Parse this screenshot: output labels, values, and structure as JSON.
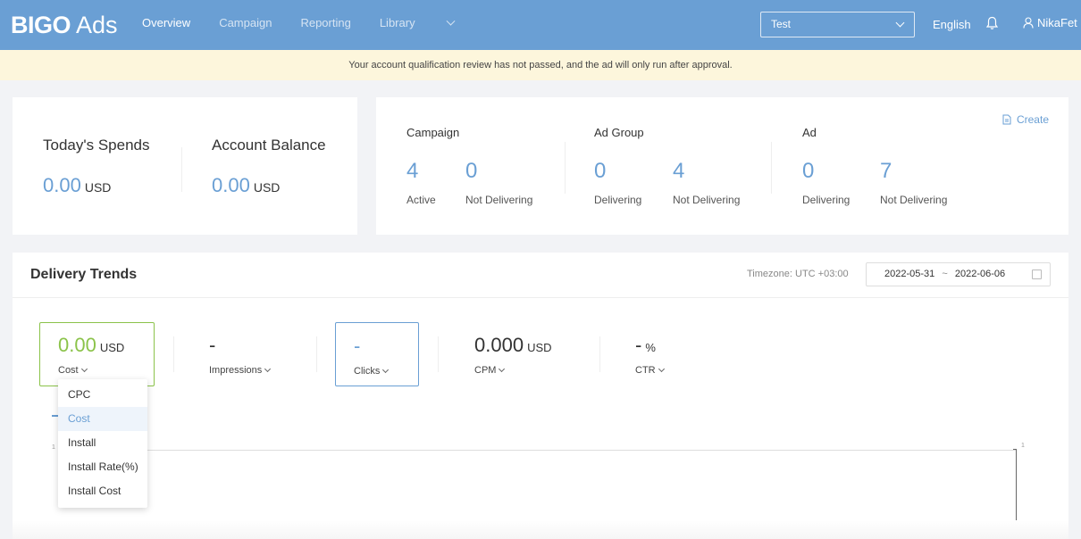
{
  "brand": {
    "bold": "BIGO",
    "light": "Ads"
  },
  "nav": {
    "overview": "Overview",
    "campaign": "Campaign",
    "reporting": "Reporting",
    "library": "Library"
  },
  "account_select": "Test",
  "language": "English",
  "user": "NikaFet",
  "banner": "Your account qualification review has not passed, and the ad will only run after approval.",
  "spend": {
    "today_label": "Today's Spends",
    "today_value": "0.00",
    "today_unit": "USD",
    "balance_label": "Account Balance",
    "balance_value": "0.00",
    "balance_unit": "USD"
  },
  "counts": {
    "create": "Create",
    "campaign": {
      "title": "Campaign",
      "a_num": "4",
      "a_label": "Active",
      "b_num": "0",
      "b_label": "Not Delivering"
    },
    "adgroup": {
      "title": "Ad Group",
      "a_num": "0",
      "a_label": "Delivering",
      "b_num": "4",
      "b_label": "Not Delivering"
    },
    "ad": {
      "title": "Ad",
      "a_num": "0",
      "a_label": "Delivering",
      "b_num": "7",
      "b_label": "Not Delivering"
    }
  },
  "trends": {
    "title": "Delivery Trends",
    "timezone": "Timezone: UTC +03:00",
    "date_start": "2022-05-31",
    "date_sep": "~",
    "date_end": "2022-06-06",
    "metrics": {
      "cost": {
        "value": "0.00",
        "unit": "USD",
        "label": "Cost"
      },
      "impressions": {
        "value": "-",
        "label": "Impressions"
      },
      "clicks": {
        "value": "-",
        "label": "Clicks"
      },
      "cpm": {
        "value": "0.000",
        "unit": "USD",
        "label": "CPM"
      },
      "ctr": {
        "value": "-",
        "unit": "%",
        "label": "CTR"
      }
    },
    "axis_left": "1",
    "axis_right": "1"
  },
  "dropdown": {
    "o1": "CPC",
    "o2": "Cost",
    "o3": "Install",
    "o4": "Install Rate(%)",
    "o5": "Install Cost"
  },
  "colors": {
    "header": "#6a9fd4",
    "accent": "#6a9fd4",
    "green": "#8bc34a",
    "banner": "#fdf6dc"
  }
}
